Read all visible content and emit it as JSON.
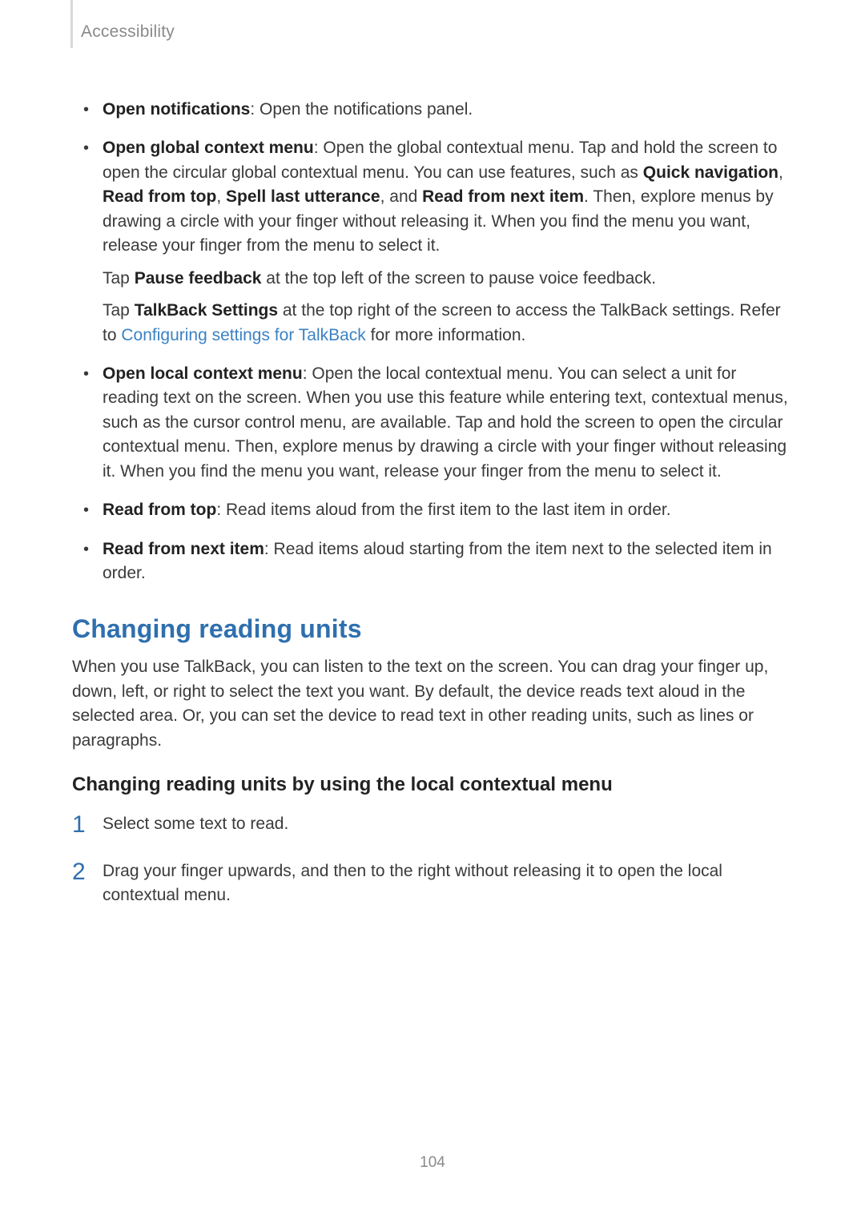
{
  "header": {
    "title": "Accessibility"
  },
  "bullets": [
    {
      "segments": [
        {
          "text": "Open notifications",
          "bold": true
        },
        {
          "text": ": Open the notifications panel."
        }
      ]
    },
    {
      "segments": [
        {
          "text": "Open global context menu",
          "bold": true
        },
        {
          "text": ": Open the global contextual menu. Tap and hold the screen to open the circular global contextual menu. You can use features, such as "
        },
        {
          "text": "Quick navigation",
          "bold": true
        },
        {
          "text": ", "
        },
        {
          "text": "Read from top",
          "bold": true
        },
        {
          "text": ", "
        },
        {
          "text": "Spell last utterance",
          "bold": true
        },
        {
          "text": ", and "
        },
        {
          "text": "Read from next item",
          "bold": true
        },
        {
          "text": ". Then, explore menus by drawing a circle with your finger without releasing it. When you find the menu you want, release your finger from the menu to select it."
        }
      ],
      "subs": [
        {
          "segments": [
            {
              "text": "Tap "
            },
            {
              "text": "Pause feedback",
              "bold": true
            },
            {
              "text": " at the top left of the screen to pause voice feedback."
            }
          ]
        },
        {
          "segments": [
            {
              "text": "Tap "
            },
            {
              "text": "TalkBack Settings",
              "bold": true
            },
            {
              "text": " at the top right of the screen to access the TalkBack settings. Refer to "
            },
            {
              "text": "Configuring settings for TalkBack",
              "link": true
            },
            {
              "text": " for more information."
            }
          ]
        }
      ]
    },
    {
      "segments": [
        {
          "text": "Open local context menu",
          "bold": true
        },
        {
          "text": ": Open the local contextual menu. You can select a unit for reading text on the screen. When you use this feature while entering text, contextual menus, such as the cursor control menu, are available. Tap and hold the screen to open the circular contextual menu. Then, explore menus by drawing a circle with your finger without releasing it. When you find the menu you want, release your finger from the menu to select it."
        }
      ]
    },
    {
      "segments": [
        {
          "text": "Read from top",
          "bold": true
        },
        {
          "text": ": Read items aloud from the first item to the last item in order."
        }
      ]
    },
    {
      "segments": [
        {
          "text": "Read from next item",
          "bold": true
        },
        {
          "text": ": Read items aloud starting from the item next to the selected item in order."
        }
      ]
    }
  ],
  "section_heading": "Changing reading units",
  "section_body": "When you use TalkBack, you can listen to the text on the screen. You can drag your finger up, down, left, or right to select the text you want. By default, the device reads text aloud in the selected area. Or, you can set the device to read text in other reading units, such as lines or paragraphs.",
  "subheading": "Changing reading units by using the local contextual menu",
  "steps": [
    {
      "num": "1",
      "text": "Select some text to read."
    },
    {
      "num": "2",
      "text": "Drag your finger upwards, and then to the right without releasing it to open the local contextual menu."
    }
  ],
  "page_number": "104"
}
